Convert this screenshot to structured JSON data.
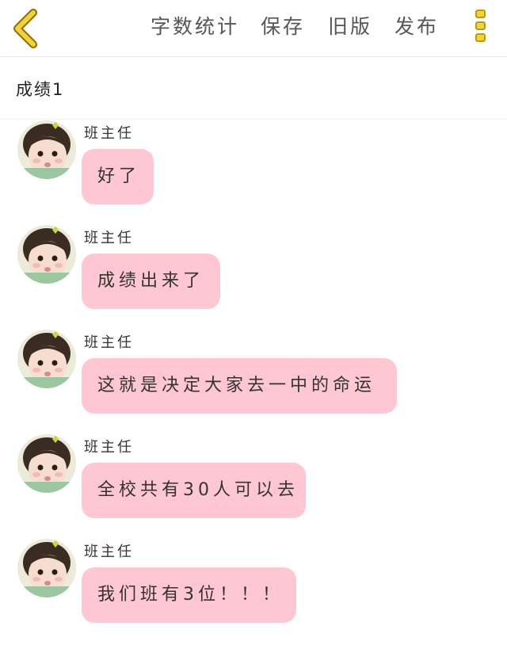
{
  "header": {
    "back_icon": "chevron-left-icon",
    "accent_color": "#f4d338",
    "actions": [
      "字数统计",
      "保存",
      "旧版",
      "发布"
    ],
    "more_icon": "more-vertical-icon"
  },
  "document": {
    "title": "成绩1"
  },
  "messages": [
    {
      "sender": "班主任",
      "text": "好了"
    },
    {
      "sender": "班主任",
      "text": "成绩出来了"
    },
    {
      "sender": "班主任",
      "text": "这就是决定大家去一中的命运"
    },
    {
      "sender": "班主任",
      "text": "全校共有30人可以去"
    },
    {
      "sender": "班主任",
      "text": "我们班有3位！！！"
    }
  ],
  "bubble_color": "#fec7d2"
}
